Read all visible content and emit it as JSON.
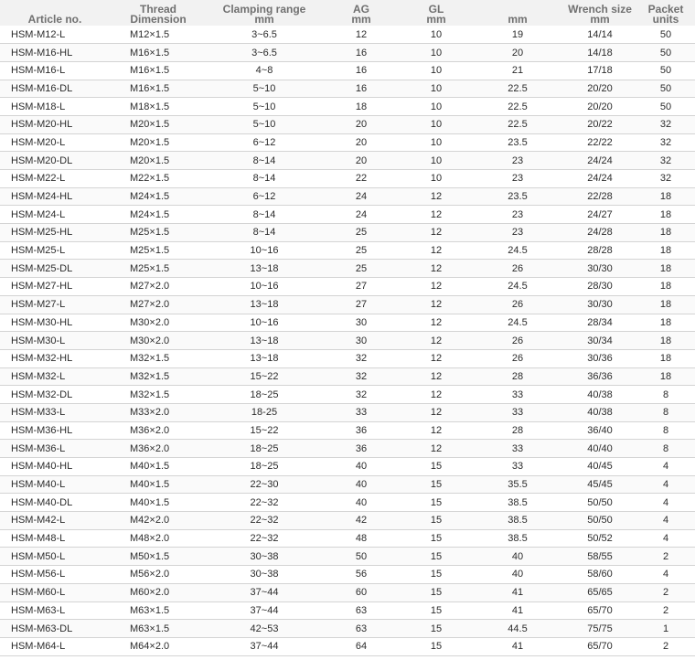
{
  "columns": [
    {
      "key": "article",
      "line1": "Article no.",
      "line2": ""
    },
    {
      "key": "thread",
      "line1": "Thread",
      "line2": "Dimension"
    },
    {
      "key": "clamping",
      "line1": "Clamping  range",
      "line2": "mm"
    },
    {
      "key": "ag",
      "line1": "AG",
      "line2": "mm"
    },
    {
      "key": "gl",
      "line1": "GL",
      "line2": "mm"
    },
    {
      "key": "mm",
      "line1": "",
      "line2": "mm"
    },
    {
      "key": "wrench",
      "line1": "Wrench size",
      "line2": "mm"
    },
    {
      "key": "packet",
      "line1": "Packet",
      "line2": "units"
    }
  ],
  "rows": [
    [
      "HSM-M12-L",
      "M12×1.5",
      "3~6.5",
      "12",
      "10",
      "19",
      "14/14",
      "50"
    ],
    [
      "HSM-M16-HL",
      "M16×1.5",
      "3~6.5",
      "16",
      "10",
      "20",
      "14/18",
      "50"
    ],
    [
      "HSM-M16-L",
      "M16×1.5",
      "4~8",
      "16",
      "10",
      "21",
      "17/18",
      "50"
    ],
    [
      "HSM-M16-DL",
      "M16×1.5",
      "5~10",
      "16",
      "10",
      "22.5",
      "20/20",
      "50"
    ],
    [
      "HSM-M18-L",
      "M18×1.5",
      "5~10",
      "18",
      "10",
      "22.5",
      "20/20",
      "50"
    ],
    [
      "HSM-M20-HL",
      "M20×1.5",
      "5~10",
      "20",
      "10",
      "22.5",
      "20/22",
      "32"
    ],
    [
      "HSM-M20-L",
      "M20×1.5",
      "6~12",
      "20",
      "10",
      "23.5",
      "22/22",
      "32"
    ],
    [
      "HSM-M20-DL",
      "M20×1.5",
      "8~14",
      "20",
      "10",
      "23",
      "24/24",
      "32"
    ],
    [
      "HSM-M22-L",
      "M22×1.5",
      "8~14",
      "22",
      "10",
      "23",
      "24/24",
      "32"
    ],
    [
      "HSM-M24-HL",
      "M24×1.5",
      "6~12",
      "24",
      "12",
      "23.5",
      "22/28",
      "18"
    ],
    [
      "HSM-M24-L",
      "M24×1.5",
      "8~14",
      "24",
      "12",
      "23",
      "24/27",
      "18"
    ],
    [
      "HSM-M25-HL",
      "M25×1.5",
      "8~14",
      "25",
      "12",
      "23",
      "24/28",
      "18"
    ],
    [
      "HSM-M25-L",
      "M25×1.5",
      "10~16",
      "25",
      "12",
      "24.5",
      "28/28",
      "18"
    ],
    [
      "HSM-M25-DL",
      "M25×1.5",
      "13~18",
      "25",
      "12",
      "26",
      "30/30",
      "18"
    ],
    [
      "HSM-M27-HL",
      "M27×2.0",
      "10~16",
      "27",
      "12",
      "24.5",
      "28/30",
      "18"
    ],
    [
      "HSM-M27-L",
      "M27×2.0",
      "13~18",
      "27",
      "12",
      "26",
      "30/30",
      "18"
    ],
    [
      "HSM-M30-HL",
      "M30×2.0",
      "10~16",
      "30",
      "12",
      "24.5",
      "28/34",
      "18"
    ],
    [
      "HSM-M30-L",
      "M30×2.0",
      "13~18",
      "30",
      "12",
      "26",
      "30/34",
      "18"
    ],
    [
      "HSM-M32-HL",
      "M32×1.5",
      "13~18",
      "32",
      "12",
      "26",
      "30/36",
      "18"
    ],
    [
      "HSM-M32-L",
      "M32×1.5",
      "15~22",
      "32",
      "12",
      "28",
      "36/36",
      "18"
    ],
    [
      "HSM-M32-DL",
      "M32×1.5",
      "18~25",
      "32",
      "12",
      "33",
      "40/38",
      "8"
    ],
    [
      "HSM-M33-L",
      "M33×2.0",
      "18-25",
      "33",
      "12",
      "33",
      "40/38",
      "8"
    ],
    [
      "HSM-M36-HL",
      "M36×2.0",
      "15~22",
      "36",
      "12",
      "28",
      "36/40",
      "8"
    ],
    [
      "HSM-M36-L",
      "M36×2.0",
      "18~25",
      "36",
      "12",
      "33",
      "40/40",
      "8"
    ],
    [
      "HSM-M40-HL",
      "M40×1.5",
      "18~25",
      "40",
      "15",
      "33",
      "40/45",
      "4"
    ],
    [
      "HSM-M40-L",
      "M40×1.5",
      "22~30",
      "40",
      "15",
      "35.5",
      "45/45",
      "4"
    ],
    [
      "HSM-M40-DL",
      "M40×1.5",
      "22~32",
      "40",
      "15",
      "38.5",
      "50/50",
      "4"
    ],
    [
      "HSM-M42-L",
      "M42×2.0",
      "22~32",
      "42",
      "15",
      "38.5",
      "50/50",
      "4"
    ],
    [
      "HSM-M48-L",
      "M48×2.0",
      "22~32",
      "48",
      "15",
      "38.5",
      "50/52",
      "4"
    ],
    [
      "HSM-M50-L",
      "M50×1.5",
      "30~38",
      "50",
      "15",
      "40",
      "58/55",
      "2"
    ],
    [
      "HSM-M56-L",
      "M56×2.0",
      "30~38",
      "56",
      "15",
      "40",
      "58/60",
      "4"
    ],
    [
      "HSM-M60-L",
      "M60×2.0",
      "37~44",
      "60",
      "15",
      "41",
      "65/65",
      "2"
    ],
    [
      "HSM-M63-L",
      "M63×1.5",
      "37~44",
      "63",
      "15",
      "41",
      "65/70",
      "2"
    ],
    [
      "HSM-M63-DL",
      "M63×1.5",
      "42~53",
      "63",
      "15",
      "44.5",
      "75/75",
      "1"
    ],
    [
      "HSM-M64-L",
      "M64×2.0",
      "37~44",
      "64",
      "15",
      "41",
      "65/70",
      "2"
    ]
  ]
}
